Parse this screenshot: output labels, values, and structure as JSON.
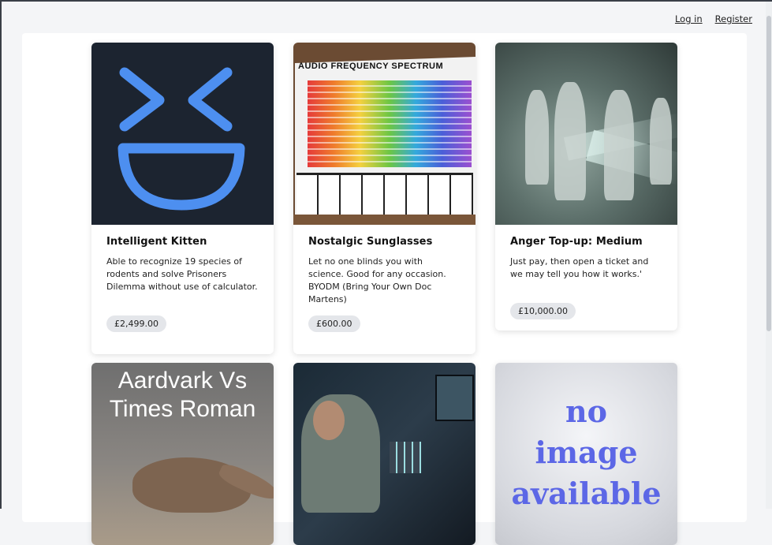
{
  "nav": {
    "login": "Log in",
    "register": "Register"
  },
  "products": [
    {
      "title": "Intelligent Kitten",
      "description": "Able to recognize 19 species of rodents and solve Prisoners Dilemma without use of calculator.",
      "price": "£2,499.00",
      "image": "laughing-face-icon"
    },
    {
      "title": "Nostalgic Sunglasses",
      "description": "Let no one blinds you with science. Good for any occasion. BYODM (Bring Your Own Doc Martens)",
      "price": "£600.00",
      "image": "audio-frequency-spectrum-chart",
      "image_text": "AUDIO FREQUENCY SPECTRUM"
    },
    {
      "title": "Anger Top-up: Medium",
      "description": "Just pay, then open a ticket and we may tell you how it works.'",
      "price": "£10,000.00",
      "image": "hazmat-figures-in-smoke"
    },
    {
      "image": "aardvark-photo",
      "image_text_line1": "Aardvark Vs",
      "image_text_line2": "Times Roman"
    },
    {
      "image": "dj-studio-photo"
    },
    {
      "image": "no-image-placeholder",
      "image_text_line1": "no",
      "image_text_line2": "image",
      "image_text_line3": "available"
    }
  ],
  "colors": {
    "accent_smiley": "#4d8ff0",
    "price_badge_bg": "#e4e6ea",
    "placeholder_text": "#5c67e6"
  }
}
